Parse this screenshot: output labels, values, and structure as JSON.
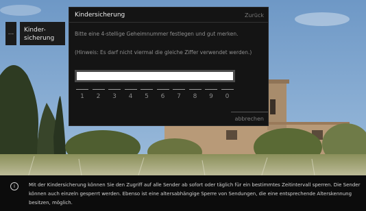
{
  "breadcrumb": {
    "prev_label": "...",
    "current_label": "Kinder-\nsicherung"
  },
  "dialog": {
    "title": "Kindersicherung",
    "back_label": "Zurück",
    "message": "Bitte eine 4-stellige Geheimnummer festlegen und gut merken.",
    "hint": "(Hinweis: Es darf nicht viermal die gleiche Ziffer verwendet werden.)",
    "pin_value": "",
    "digits": [
      "1",
      "2",
      "3",
      "4",
      "5",
      "6",
      "7",
      "8",
      "9",
      "0"
    ],
    "cancel_label": "abbrechen"
  },
  "info": {
    "icon": "info-icon",
    "text": "Mit der Kindersicherung können Sie den Zugriff auf alle Sender ab sofort oder täglich für ein bestimmtes Zeitintervall sperren. Die Sender können auch einzeln gesperrt werden. Ebenso ist eine altersabhängige Sperre von Sendungen, die eine entsprechende Alterskennung besitzen, möglich."
  }
}
